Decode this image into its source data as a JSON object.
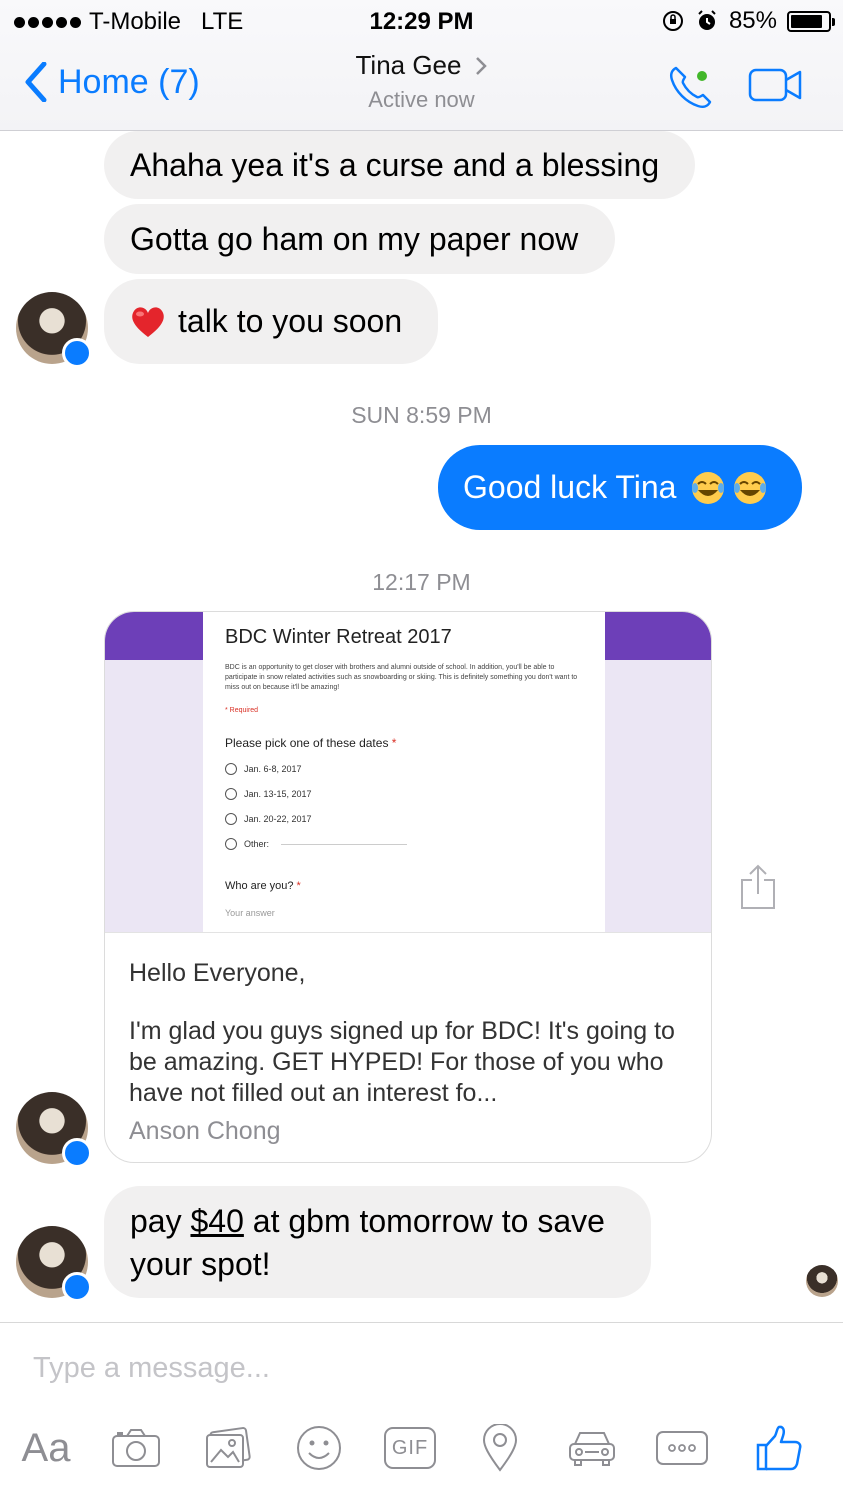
{
  "status": {
    "carrier": "T-Mobile",
    "network": "LTE",
    "time": "12:29 PM",
    "battery": "85%",
    "battery_level": 0.85
  },
  "nav": {
    "back_label": "Home (7)",
    "contact_name": "Tina Gee",
    "presence": "Active now"
  },
  "messages": {
    "m1": "Ahaha yea it's a curse and a blessing",
    "m2": "Gotta go ham on my paper now",
    "m3": "talk to you soon",
    "ts1": "SUN 8:59 PM",
    "out1": "Good luck Tina",
    "ts2": "12:17 PM",
    "m4_pre": "pay ",
    "m4_link": "$40",
    "m4_post": " at gbm tomorrow to save your spot!"
  },
  "card": {
    "form_title": "BDC Winter Retreat 2017",
    "form_desc": "BDC is an opportunity to get closer with brothers and alumni outside of school. In addition, you'll be able to participate in snow related activities such as snowboarding or skiing. This is definitely something you don't want to miss out on because it'll be amazing!",
    "required": "* Required",
    "question1": "Please pick one of these dates",
    "options": [
      "Jan. 6-8, 2017",
      "Jan. 13-15, 2017",
      "Jan. 20-22, 2017",
      "Other:"
    ],
    "question2": "Who are you?",
    "answer_placeholder": "Your answer",
    "greeting": "Hello Everyone,",
    "body": "I'm glad you guys signed up for BDC! It's going to be amazing. GET HYPED! For those of you who have not filled out an interest fo...",
    "author": "Anson Chong"
  },
  "composer": {
    "placeholder": "Type a message...",
    "aa_label": "Aa",
    "gif_label": "GIF"
  },
  "colors": {
    "accent": "#0a7cff",
    "incoming_bubble": "#f1f0f0",
    "form_purple": "#6d3fb8"
  },
  "icons": [
    "chevron-left-icon",
    "chevron-right-icon",
    "phone-icon",
    "video-camera-icon",
    "heart-emoji",
    "laughing-emoji",
    "share-icon",
    "camera-icon",
    "photo-icon",
    "smiley-icon",
    "gif-icon",
    "location-icon",
    "car-icon",
    "more-icon",
    "thumbs-up-icon"
  ]
}
